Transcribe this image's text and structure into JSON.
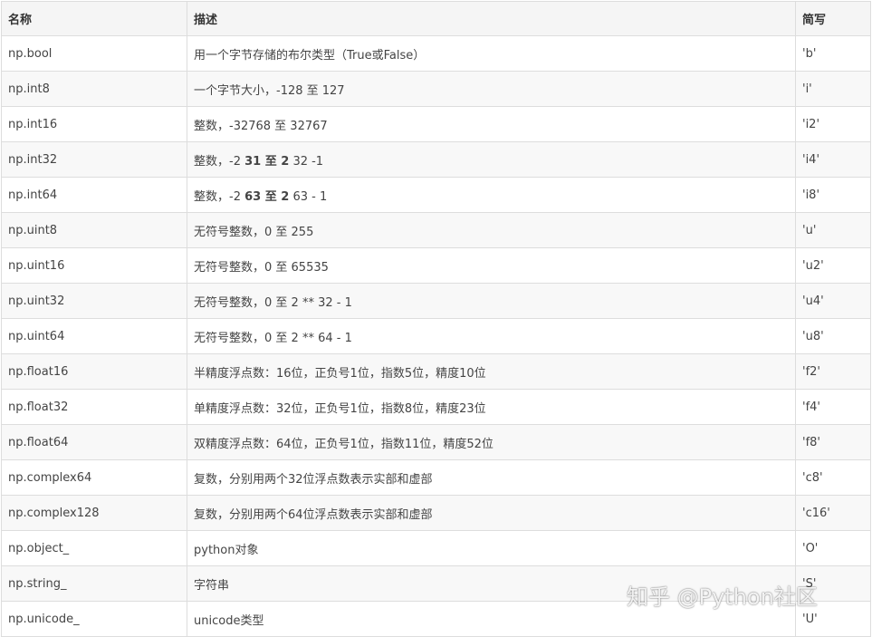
{
  "table": {
    "headers": [
      "名称",
      "描述",
      "简写"
    ],
    "rows": [
      {
        "name": "np.bool",
        "desc": "用一个字节存储的布尔类型（True或False）",
        "abbr": "'b'"
      },
      {
        "name": "np.int8",
        "desc": "一个字节大小，-128 至 127",
        "abbr": "'i'"
      },
      {
        "name": "np.int16",
        "desc": "整数，-32768 至 32767",
        "abbr": "'i2'"
      },
      {
        "name": "np.int32",
        "desc_parts": [
          "整数，-2 ",
          "31 至 2",
          " 32 -1"
        ],
        "abbr": "'i4'"
      },
      {
        "name": "np.int64",
        "desc_parts": [
          "整数，-2 ",
          "63 至 2",
          " 63 - 1"
        ],
        "abbr": "'i8'"
      },
      {
        "name": "np.uint8",
        "desc": "无符号整数，0 至 255",
        "abbr": "'u'"
      },
      {
        "name": "np.uint16",
        "desc": "无符号整数，0 至 65535",
        "abbr": "'u2'"
      },
      {
        "name": "np.uint32",
        "desc": "无符号整数，0 至 2 ** 32 - 1",
        "abbr": "'u4'"
      },
      {
        "name": "np.uint64",
        "desc": "无符号整数，0 至 2 ** 64 - 1",
        "abbr": "'u8'"
      },
      {
        "name": "np.float16",
        "desc": "半精度浮点数：16位，正负号1位，指数5位，精度10位",
        "abbr": "'f2'"
      },
      {
        "name": "np.float32",
        "desc": "单精度浮点数：32位，正负号1位，指数8位，精度23位",
        "abbr": "'f4'"
      },
      {
        "name": "np.float64",
        "desc": "双精度浮点数：64位，正负号1位，指数11位，精度52位",
        "abbr": "'f8'"
      },
      {
        "name": "np.complex64",
        "desc": "复数，分别用两个32位浮点数表示实部和虚部",
        "abbr": "'c8'"
      },
      {
        "name": "np.complex128",
        "desc": "复数，分别用两个64位浮点数表示实部和虚部",
        "abbr": "'c16'"
      },
      {
        "name": "np.object_",
        "desc": "python对象",
        "abbr": "'O'"
      },
      {
        "name": "np.string_",
        "desc": "字符串",
        "abbr": "'S'"
      },
      {
        "name": "np.unicode_",
        "desc": "unicode类型",
        "abbr": "'U'"
      }
    ]
  },
  "watermark": "知乎 @Python社区"
}
